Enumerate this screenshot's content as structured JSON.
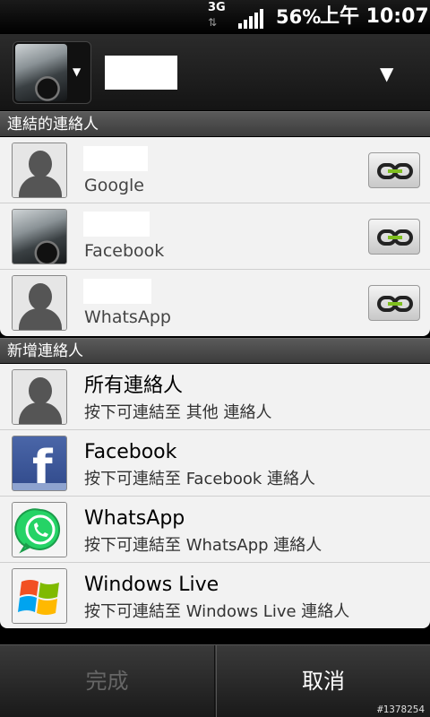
{
  "status_bar": {
    "network": "3G",
    "network_arrows": "⇅",
    "battery": "56%",
    "time": "上午 10:07"
  },
  "sections": {
    "linked": "連結的連絡人",
    "add": "新增連絡人"
  },
  "linked_contacts": [
    {
      "account": "Google",
      "avatar": "person-silhouette"
    },
    {
      "account": "Facebook",
      "avatar": "car-photo"
    },
    {
      "account": "WhatsApp",
      "avatar": "person-silhouette"
    }
  ],
  "add_contacts": [
    {
      "title": "所有連絡人",
      "subtitle": "按下可連結至 其他 連絡人",
      "icon": "person-silhouette"
    },
    {
      "title": "Facebook",
      "subtitle": "按下可連結至 Facebook 連絡人",
      "icon": "facebook-icon"
    },
    {
      "title": "WhatsApp",
      "subtitle": "按下可連結至 WhatsApp 連絡人",
      "icon": "whatsapp-icon"
    },
    {
      "title": "Windows Live",
      "subtitle": "按下可連結至 Windows Live 連絡人",
      "icon": "windows-live-icon"
    }
  ],
  "buttons": {
    "done": "完成",
    "cancel": "取消"
  },
  "watermark": "#1378254",
  "colors": {
    "accent_link": "#7fbf1f",
    "facebook": "#3b5998",
    "whatsapp": "#25d366"
  }
}
